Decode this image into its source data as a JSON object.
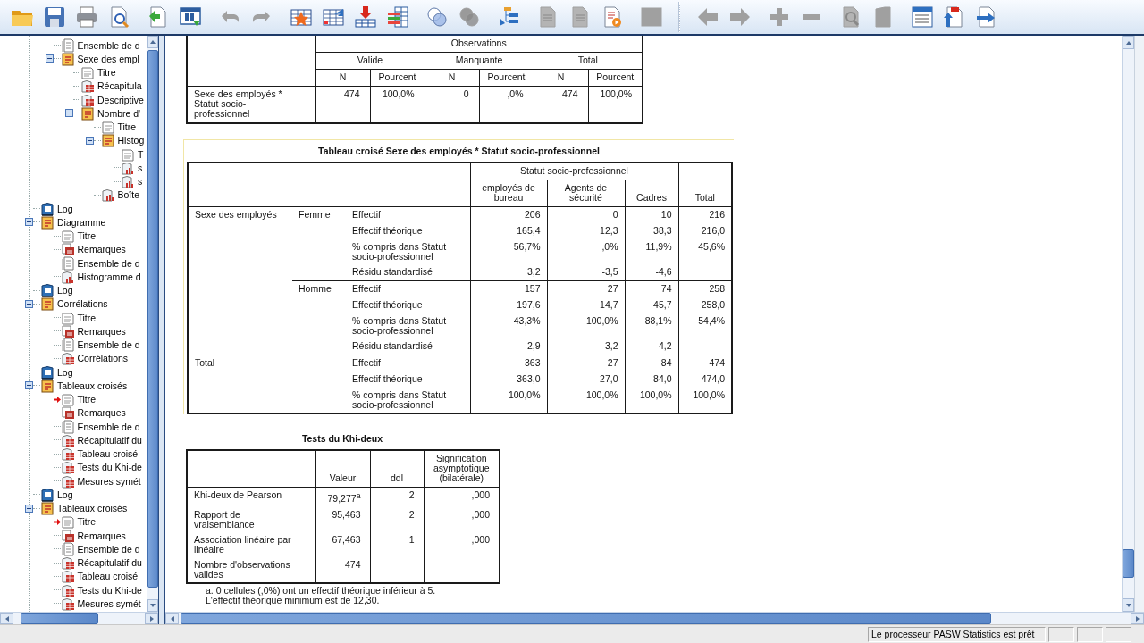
{
  "toolbar": [
    [
      {
        "kind": "open",
        "disabled": false
      },
      {
        "kind": "save",
        "disabled": false
      },
      {
        "kind": "print",
        "disabled": false
      },
      {
        "kind": "preview",
        "disabled": false
      }
    ],
    [
      {
        "kind": "export",
        "disabled": false
      },
      {
        "kind": "recall",
        "disabled": false
      }
    ],
    [
      {
        "kind": "undo",
        "disabled": true
      },
      {
        "kind": "redo",
        "disabled": true
      }
    ],
    [
      {
        "kind": "goto-case",
        "disabled": false
      },
      {
        "kind": "goto-var",
        "disabled": false
      },
      {
        "kind": "insert",
        "disabled": false
      },
      {
        "kind": "variables",
        "disabled": false
      }
    ],
    [
      {
        "kind": "circles",
        "disabled": false
      },
      {
        "kind": "circles",
        "disabled": true
      }
    ],
    [
      {
        "kind": "tree",
        "disabled": false
      }
    ],
    [
      {
        "kind": "doc",
        "disabled": true
      },
      {
        "kind": "doc",
        "disabled": true
      },
      {
        "kind": "doc-play",
        "disabled": false
      }
    ],
    [
      {
        "kind": "frame",
        "disabled": true
      }
    ],
    [
      {
        "kind": "back",
        "disabled": true
      },
      {
        "kind": "forward",
        "disabled": true
      }
    ],
    [
      {
        "kind": "expand",
        "disabled": true
      },
      {
        "kind": "collapse",
        "disabled": true
      }
    ],
    [
      {
        "kind": "doc-zoom",
        "disabled": true
      },
      {
        "kind": "book",
        "disabled": true
      }
    ],
    [
      {
        "kind": "list-window",
        "disabled": false
      },
      {
        "kind": "doc-up",
        "disabled": false
      },
      {
        "kind": "doc-right",
        "disabled": false
      }
    ]
  ],
  "outline": [
    {
      "children": [
        {
          "label": "Ensemble de d",
          "kind": "text",
          "current": false
        },
        {
          "label": "Sexe des empl",
          "kind": "heading",
          "current": false,
          "expanded": true,
          "children": [
            {
              "label": "Titre",
              "kind": "title",
              "current": false
            },
            {
              "label": "Récapitula",
              "kind": "table",
              "current": false
            },
            {
              "label": "Descriptive",
              "kind": "table",
              "current": false
            },
            {
              "label": "Nombre d'",
              "kind": "heading",
              "current": false,
              "expanded": true,
              "children": [
                {
                  "label": "Titre",
                  "kind": "title",
                  "current": false
                },
                {
                  "label": "Histog",
                  "kind": "heading",
                  "current": false,
                  "expanded": true,
                  "children": [
                    {
                      "label": "T",
                      "kind": "title",
                      "current": false
                    },
                    {
                      "label": "s",
                      "kind": "chart",
                      "current": false
                    },
                    {
                      "label": "s",
                      "kind": "chart",
                      "current": false
                    }
                  ]
                },
                {
                  "label": "Boîte",
                  "kind": "chart",
                  "current": false
                }
              ]
            }
          ]
        }
      ]
    },
    {
      "label": "Log",
      "kind": "log",
      "current": false
    },
    {
      "label": "Diagramme",
      "kind": "heading",
      "current": false,
      "expanded": true,
      "children": [
        {
          "label": "Titre",
          "kind": "title",
          "current": false
        },
        {
          "label": "Remarques",
          "kind": "notes",
          "current": false
        },
        {
          "label": "Ensemble de d",
          "kind": "text",
          "current": false
        },
        {
          "label": "Histogramme d",
          "kind": "chart",
          "current": false
        }
      ]
    },
    {
      "label": "Log",
      "kind": "log",
      "current": false
    },
    {
      "label": "Corrélations",
      "kind": "heading",
      "current": false,
      "expanded": true,
      "children": [
        {
          "label": "Titre",
          "kind": "title",
          "current": false
        },
        {
          "label": "Remarques",
          "kind": "notes",
          "current": false
        },
        {
          "label": "Ensemble de d",
          "kind": "text",
          "current": false
        },
        {
          "label": "Corrélations",
          "kind": "table",
          "current": false
        }
      ]
    },
    {
      "label": "Log",
      "kind": "log",
      "current": false
    },
    {
      "label": "Tableaux croisés",
      "kind": "heading",
      "current": false,
      "expanded": true,
      "children": [
        {
          "label": "Titre",
          "kind": "title",
          "current": true
        },
        {
          "label": "Remarques",
          "kind": "notes",
          "current": false
        },
        {
          "label": "Ensemble de d",
          "kind": "text",
          "current": false
        },
        {
          "label": "Récapitulatif du",
          "kind": "table",
          "current": false
        },
        {
          "label": "Tableau croisé",
          "kind": "table",
          "current": false
        },
        {
          "label": "Tests du Khi-de",
          "kind": "table",
          "current": false
        },
        {
          "label": "Mesures symét",
          "kind": "table",
          "current": false
        }
      ]
    },
    {
      "label": "Log",
      "kind": "log",
      "current": false
    },
    {
      "label": "Tableaux croisés",
      "kind": "heading",
      "current": false,
      "expanded": true,
      "children": [
        {
          "label": "Titre",
          "kind": "title",
          "current": true
        },
        {
          "label": "Remarques",
          "kind": "notes",
          "current": false
        },
        {
          "label": "Ensemble de d",
          "kind": "text",
          "current": false
        },
        {
          "label": "Récapitulatif du",
          "kind": "table",
          "current": false
        },
        {
          "label": "Tableau croisé",
          "kind": "table",
          "current": false
        },
        {
          "label": "Tests du Khi-de",
          "kind": "table",
          "current": false
        },
        {
          "label": "Mesures symét",
          "kind": "table",
          "current": false
        }
      ]
    }
  ],
  "summary_table": {
    "header_group": "Observations",
    "groups": [
      "Valide",
      "Manquante",
      "Total"
    ],
    "subheaders": [
      "N",
      "Pourcent",
      "N",
      "Pourcent",
      "N",
      "Pourcent"
    ],
    "rows": [
      {
        "label": "Sexe des employés *\nStatut socio-\nprofessionnel",
        "cells": [
          "474",
          "100,0%",
          "0",
          ",0%",
          "474",
          "100,0%"
        ]
      }
    ]
  },
  "crosstab": {
    "title": "Tableau croisé Sexe des employés * Statut socio-professionnel",
    "column_group": "Statut socio-professionnel",
    "columns": [
      "employés de\nbureau",
      "Agents de\nsécurité",
      "Cadres"
    ],
    "total_header": "Total",
    "row_variable": "Sexe des employés",
    "groups": [
      {
        "label": "Femme",
        "rows": [
          {
            "stat": "Effectif",
            "cells": [
              "206",
              "0",
              "10",
              "216"
            ]
          },
          {
            "stat": "Effectif théorique",
            "cells": [
              "165,4",
              "12,3",
              "38,3",
              "216,0"
            ]
          },
          {
            "stat": "% compris dans Statut\nsocio-professionnel",
            "cells": [
              "56,7%",
              ",0%",
              "11,9%",
              "45,6%"
            ]
          },
          {
            "stat": "Résidu standardisé",
            "cells": [
              "3,2",
              "-3,5",
              "-4,6"
            ]
          }
        ]
      },
      {
        "label": "Homme",
        "rows": [
          {
            "stat": "Effectif",
            "cells": [
              "157",
              "27",
              "74",
              "258"
            ]
          },
          {
            "stat": "Effectif théorique",
            "cells": [
              "197,6",
              "14,7",
              "45,7",
              "258,0"
            ]
          },
          {
            "stat": "% compris dans Statut\nsocio-professionnel",
            "cells": [
              "43,3%",
              "100,0%",
              "88,1%",
              "54,4%"
            ]
          },
          {
            "stat": "Résidu standardisé",
            "cells": [
              "-2,9",
              "3,2",
              "4,2"
            ]
          }
        ]
      }
    ],
    "total": {
      "label": "Total",
      "rows": [
        {
          "stat": "Effectif",
          "cells": [
            "363",
            "27",
            "84",
            "474"
          ]
        },
        {
          "stat": "Effectif théorique",
          "cells": [
            "363,0",
            "27,0",
            "84,0",
            "474,0"
          ]
        },
        {
          "stat": "% compris dans Statut\nsocio-professionnel",
          "cells": [
            "100,0%",
            "100,0%",
            "100,0%",
            "100,0%"
          ]
        }
      ]
    }
  },
  "chi_square": {
    "title": "Tests du Khi-deux",
    "columns": [
      "Valeur",
      "ddl",
      "Signification\nasymptotique\n(bilatérale)"
    ],
    "rows": [
      {
        "label": "Khi-deux de Pearson",
        "cells": [
          "79,277$^{a}$",
          "2",
          ",000"
        ]
      },
      {
        "label": "Rapport de\nvraisemblance",
        "cells": [
          "95,463",
          "2",
          ",000"
        ]
      },
      {
        "label": "Association linéaire par\nlinéaire",
        "cells": [
          "67,463",
          "1",
          ",000"
        ]
      },
      {
        "label": "Nombre d'observations\nvalides",
        "cells": [
          "474"
        ]
      }
    ],
    "footnotes": [
      "a. 0 cellules (,0%) ont un effectif théorique inférieur à 5.",
      "L'effectif théorique minimum est de 12,30."
    ]
  },
  "status_bar": {
    "message": "Le processeur PASW Statistics  est prêt"
  }
}
